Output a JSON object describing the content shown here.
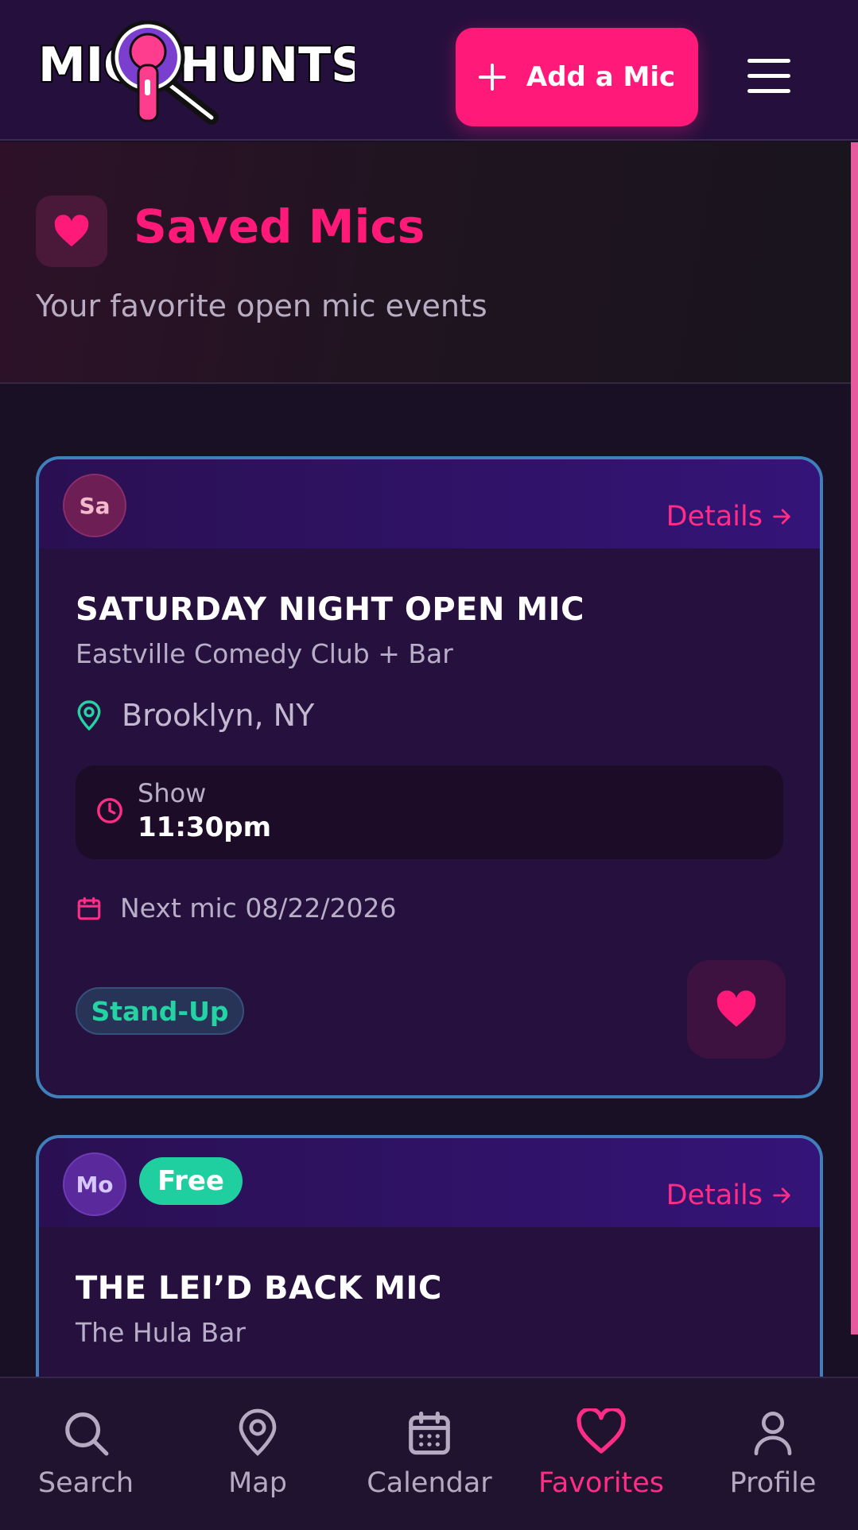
{
  "header": {
    "add_label": "Add a Mic",
    "logo_text": "MICHUNTS"
  },
  "hero": {
    "title": "Saved Mics",
    "subtitle": "Your favorite open mic events"
  },
  "cards": [
    {
      "avatar": "Sa",
      "details_label": "Details",
      "title": "SATURDAY NIGHT OPEN MIC",
      "venue": "Eastville Comedy Club + Bar",
      "location": "Brooklyn, NY",
      "time_label": "Show",
      "time_value": "11:30pm",
      "next_mic": "Next mic 08/22/2026",
      "tag": "Stand-Up"
    },
    {
      "avatar": "Mo",
      "badge": "Free",
      "details_label": "Details",
      "title": "THE LEI’D BACK MIC",
      "venue": "The Hula Bar"
    }
  ],
  "nav": {
    "items": [
      {
        "label": "Search",
        "icon": "search-icon"
      },
      {
        "label": "Map",
        "icon": "map-pin-icon"
      },
      {
        "label": "Calendar",
        "icon": "calendar-icon"
      },
      {
        "label": "Favorites",
        "icon": "heart-icon",
        "active": true
      },
      {
        "label": "Profile",
        "icon": "user-icon"
      }
    ]
  },
  "colors": {
    "accent": "#ff1a7a",
    "teal": "#24d3a4",
    "card_border": "#3e7fbc",
    "background": "#1a1026"
  }
}
